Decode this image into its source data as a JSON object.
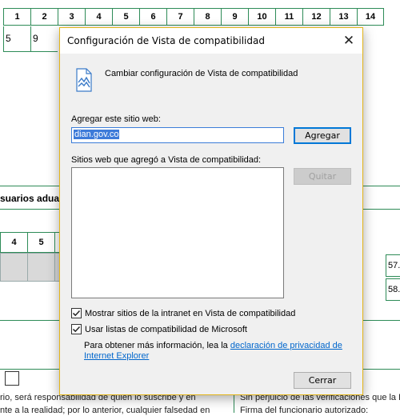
{
  "background": {
    "header_numbers": [
      "1",
      "2",
      "3",
      "4",
      "5",
      "6",
      "7",
      "8",
      "9",
      "10",
      "11",
      "12",
      "13",
      "14"
    ],
    "row_values": [
      "5",
      "9"
    ],
    "section_title": "suarios adua",
    "sub_headers": [
      "4",
      "5"
    ],
    "right_boxes": [
      "57.",
      "58."
    ],
    "footer_left_line1": "rio, será responsabilidad de quien lo suscribe y en",
    "footer_left_line2": "nte a la realidad; por lo anterior, cualquier falsedad en",
    "footer_right_line1": "Sin perjuicio de las verificaciones que la DI",
    "footer_right_line2": "Firma del funcionario autorizado:"
  },
  "dialog": {
    "title": "Configuración de Vista de compatibilidad",
    "close_glyph": "✕",
    "header": "Cambiar configuración de Vista de compatibilidad",
    "add_label": "Agregar este sitio web:",
    "url_value": "dian.gov.co",
    "add_button": "Agregar",
    "list_label": "Sitios web que agregó a Vista de compatibilidad:",
    "remove_button": "Quitar",
    "checkbox_intranet": {
      "label": "Mostrar sitios de la intranet en Vista de compatibilidad",
      "checked": true
    },
    "checkbox_microsoft": {
      "label": "Usar listas de compatibilidad de Microsoft",
      "checked": true
    },
    "info_prefix": "Para obtener más información, lea la ",
    "info_link": "declaración de privacidad de Internet Explorer",
    "close_button": "Cerrar"
  },
  "colors": {
    "form_border": "#2e8b57",
    "dialog_border": "#e3b51a",
    "link": "#0066cc",
    "selection": "#3d7bd9"
  }
}
